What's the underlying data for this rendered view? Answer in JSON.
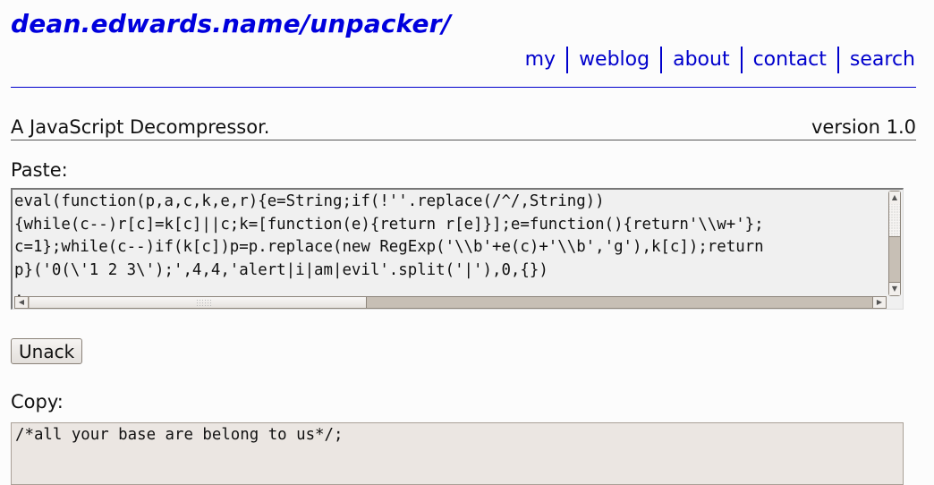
{
  "header": {
    "site_title": "dean.edwards.name/unpacker/",
    "nav": [
      {
        "label": "my"
      },
      {
        "label": "weblog"
      },
      {
        "label": "about"
      },
      {
        "label": "contact"
      },
      {
        "label": "search"
      }
    ]
  },
  "tagline": {
    "description": "A JavaScript Decompressor.",
    "version": "version 1.0"
  },
  "paste": {
    "label": "Paste:",
    "value": "eval(function(p,a,c,k,e,r){e=String;if(!''.replace(/^/,String))\n{while(c--)r[c]=k[c]||c;k=[function(e){return r[e]}];e=function(){return'\\\\w+'};\nc=1};while(c--)if(k[c])p=p.replace(new RegExp('\\\\b'+e(c)+'\\\\b','g'),k[c]);return\np}('0(\\'1 2 3\\');',4,4,'alert|i|am|evil'.split('|'),0,{})\n,"
  },
  "actions": {
    "unpack_label": "Unack"
  },
  "copy": {
    "label": "Copy:",
    "value": "/*all your base are belong to us*/;"
  },
  "colors": {
    "link": "#0000cc",
    "title": "#0000dd"
  }
}
